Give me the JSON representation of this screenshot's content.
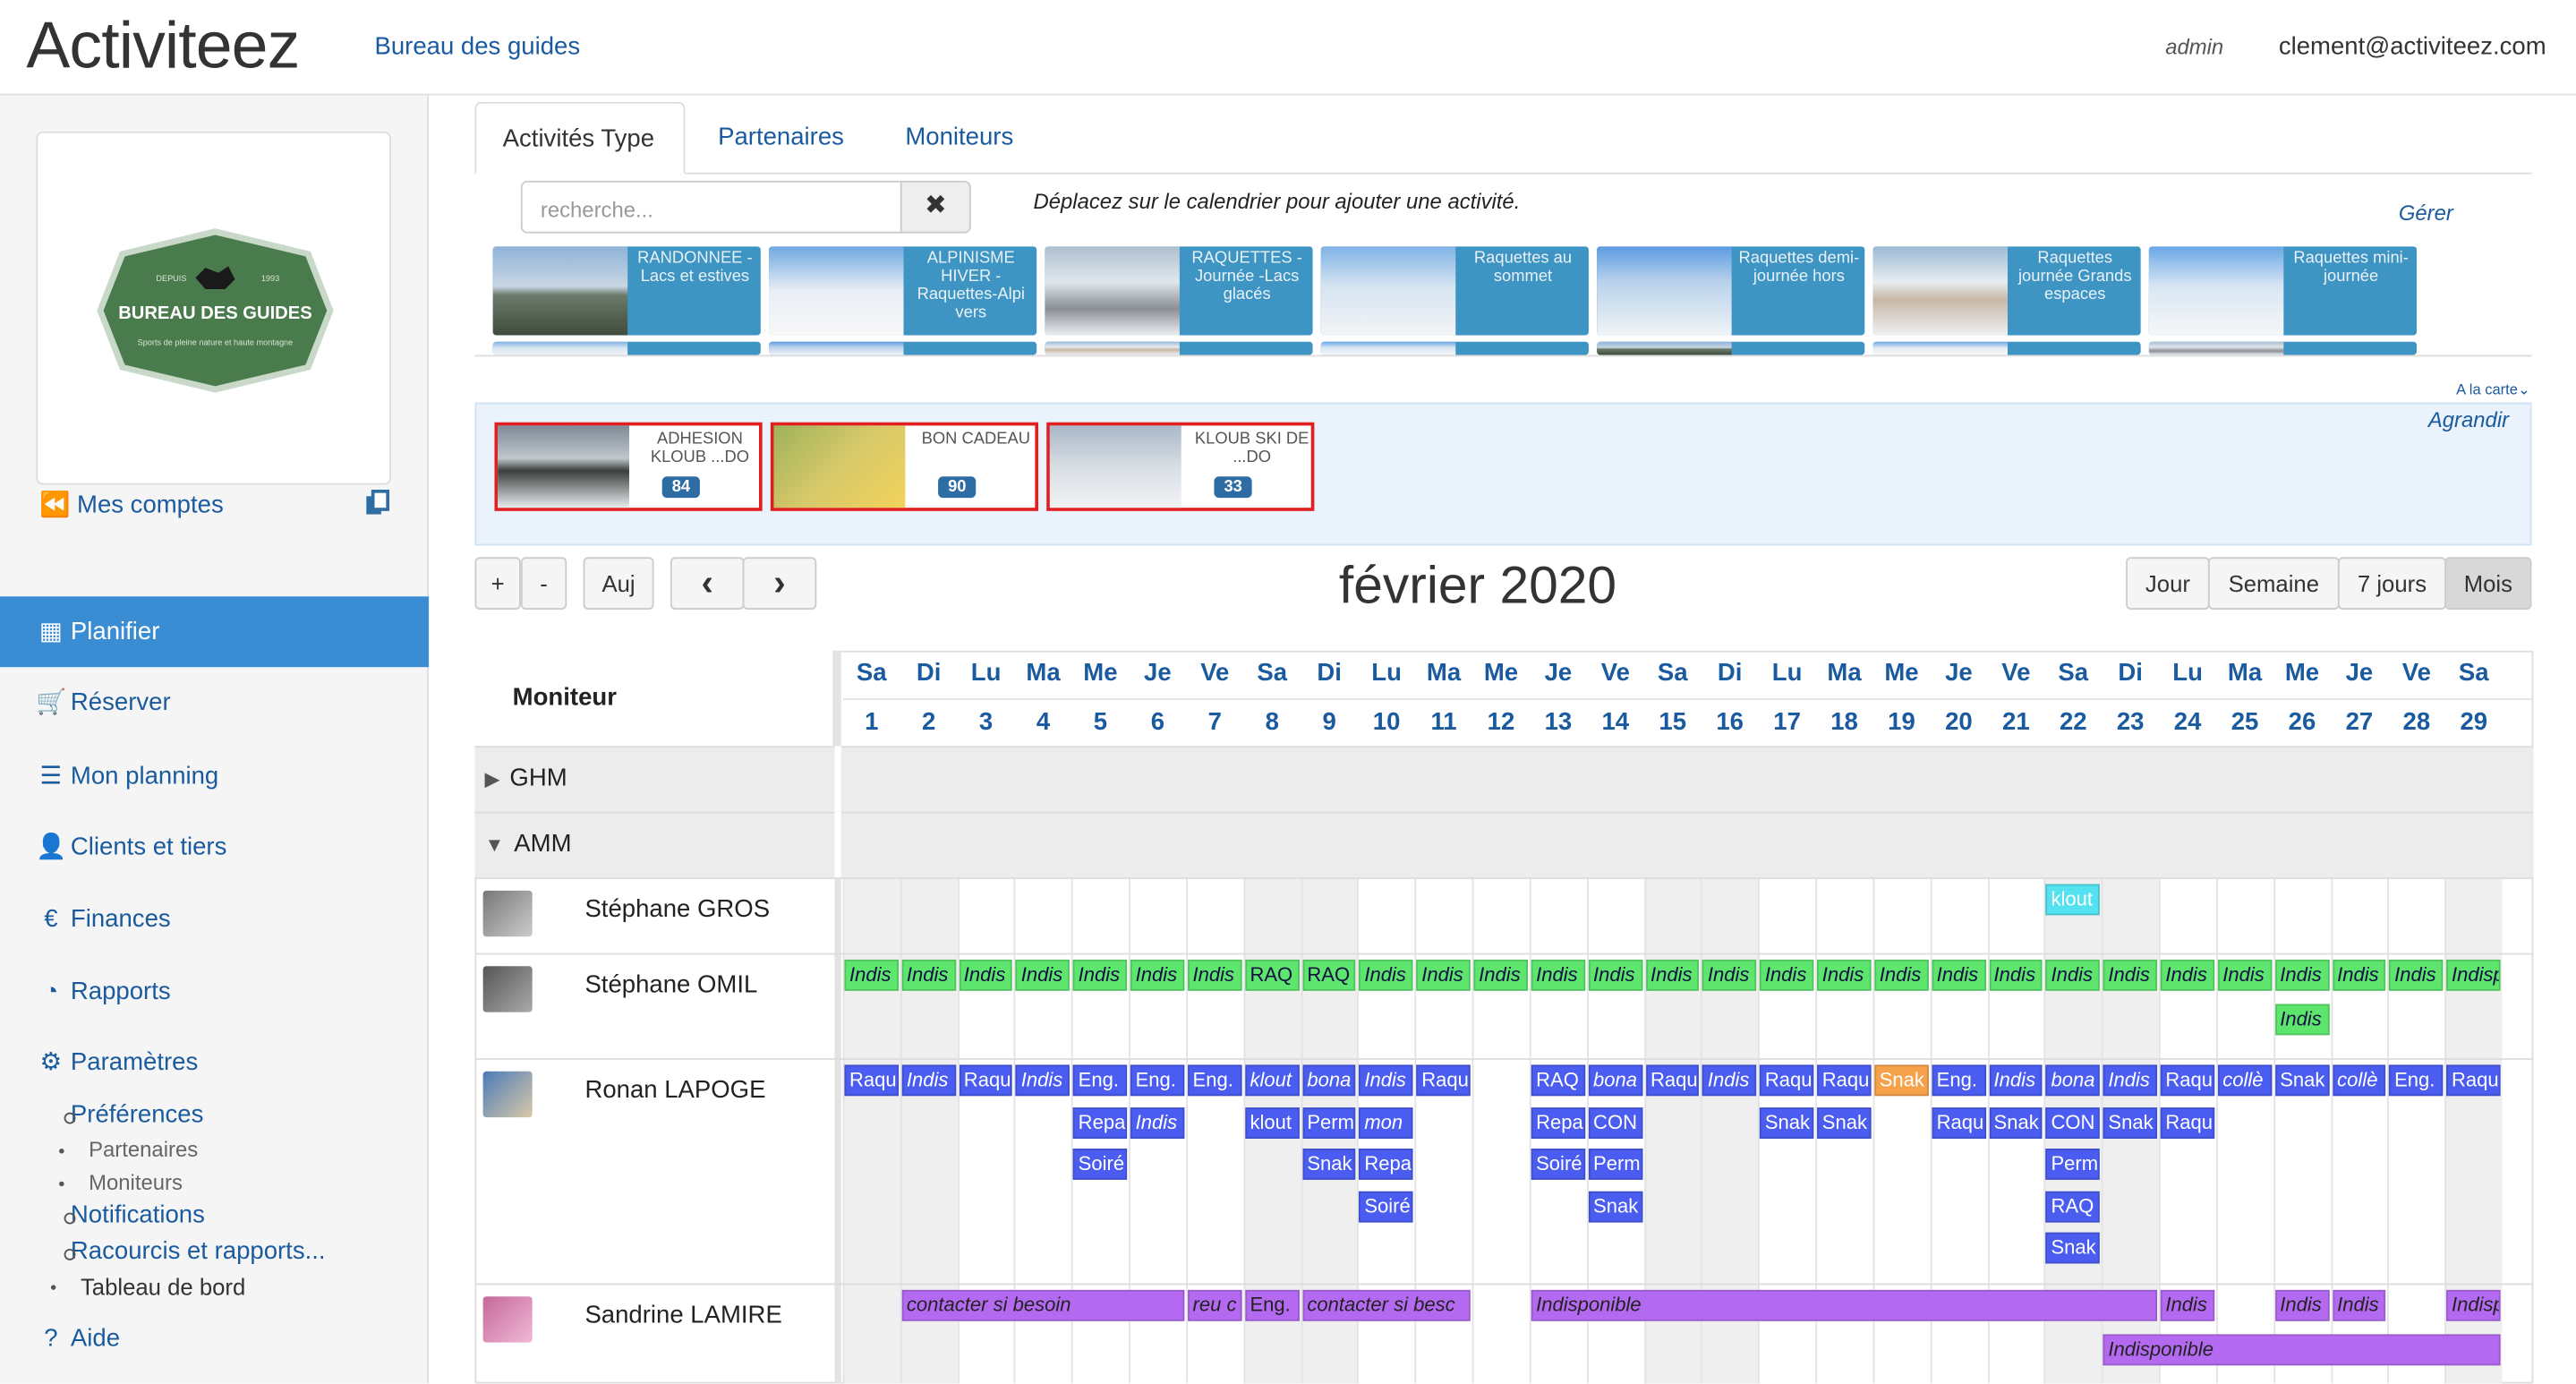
{
  "app": {
    "logo": "Activiteez",
    "office_link": "Bureau des guides",
    "user_role": "admin",
    "user_email": "clement@activiteez.com"
  },
  "sidebar": {
    "logo_text": "BUREAU DES GUIDES",
    "logo_sub": "Sports de pleine nature et haute montagne",
    "logo_year_left": "DEPUIS",
    "logo_year_right": "1993",
    "mes_comptes": "Mes comptes",
    "nav": [
      {
        "label": "Planifier",
        "icon": "calendar-icon"
      },
      {
        "label": "Réserver",
        "icon": "cart-icon"
      },
      {
        "label": "Mon planning",
        "icon": "list-icon"
      },
      {
        "label": "Clients et tiers",
        "icon": "user-icon"
      },
      {
        "label": "Finances",
        "icon": "euro-icon"
      },
      {
        "label": "Rapports",
        "icon": "dashboard-icon"
      },
      {
        "label": "Paramètres",
        "icon": "gear-icon"
      }
    ],
    "preferences": "Préférences",
    "partenaires": "Partenaires",
    "moniteurs": "Moniteurs",
    "notifications": "Notifications",
    "raccourcis": "Racourcis et rapports...",
    "tableau": "Tableau de bord",
    "aide": "Aide"
  },
  "tabs": [
    "Activités Type",
    "Partenaires",
    "Moniteurs"
  ],
  "search": {
    "placeholder": "recherche..."
  },
  "drag_hint": "Déplacez sur le calendrier pour ajouter une activité.",
  "gerer": "Gérer",
  "activity_cards": [
    {
      "label": "RANDONNEE - Lacs et estives"
    },
    {
      "label": "ALPINISME HIVER - Raquettes-Alpi vers"
    },
    {
      "label": "RAQUETTES - Journée -Lacs glacés"
    },
    {
      "label": "Raquettes au sommet"
    },
    {
      "label": "Raquettes demi-journée hors"
    },
    {
      "label": "Raquettes journée Grands espaces"
    },
    {
      "label": "Raquettes mini-journée"
    }
  ],
  "a_la_carte": "A la carte",
  "agrandir": "Agrandir",
  "carte_cards": [
    {
      "label": "ADHESION KLOUB ...DO",
      "badge": "84"
    },
    {
      "label": "BON CADEAU",
      "badge": "90"
    },
    {
      "label": "KLOUB SKI DE ...DO",
      "badge": "33"
    }
  ],
  "toolbar": {
    "plus": "+",
    "minus": "-",
    "today": "Auj",
    "prev": "‹",
    "next": "›",
    "views": [
      "Jour",
      "Semaine",
      "7 jours",
      "Mois"
    ],
    "active_view": "Mois"
  },
  "calendar": {
    "title": "février 2020",
    "moniteur_header": "Moniteur",
    "day_names": [
      "Sa",
      "Di",
      "Lu",
      "Ma",
      "Me",
      "Je",
      "Ve",
      "Sa",
      "Di",
      "Lu",
      "Ma",
      "Me",
      "Je",
      "Ve",
      "Sa",
      "Di",
      "Lu",
      "Ma",
      "Me",
      "Je",
      "Ve",
      "Sa",
      "Di",
      "Lu",
      "Ma",
      "Me",
      "Je",
      "Ve",
      "Sa"
    ],
    "day_numbers": [
      "1",
      "2",
      "3",
      "4",
      "5",
      "6",
      "7",
      "8",
      "9",
      "10",
      "11",
      "12",
      "13",
      "14",
      "15",
      "16",
      "17",
      "18",
      "19",
      "20",
      "21",
      "22",
      "23",
      "24",
      "25",
      "26",
      "27",
      "28",
      "29"
    ],
    "groups": [
      "GHM",
      "AMM"
    ],
    "moniteurs": [
      "Stéphane GROS",
      "Stéphane OMIL",
      "Ronan LAPOGE",
      "Sandrine LAMIRE"
    ],
    "events": [
      {
        "row": 0,
        "line": 0,
        "start": 22,
        "span": 1,
        "text": "klout",
        "color": "cyan",
        "italic": false
      },
      {
        "row": 1,
        "line": 0,
        "start": 1,
        "span": 1,
        "text": "Indis",
        "color": "green",
        "italic": true
      },
      {
        "row": 1,
        "line": 0,
        "start": 2,
        "span": 1,
        "text": "Indis",
        "color": "green",
        "italic": true
      },
      {
        "row": 1,
        "line": 0,
        "start": 3,
        "span": 1,
        "text": "Indis",
        "color": "green",
        "italic": true
      },
      {
        "row": 1,
        "line": 0,
        "start": 4,
        "span": 1,
        "text": "Indis",
        "color": "green",
        "italic": true
      },
      {
        "row": 1,
        "line": 0,
        "start": 5,
        "span": 1,
        "text": "Indis",
        "color": "green",
        "italic": true
      },
      {
        "row": 1,
        "line": 0,
        "start": 6,
        "span": 1,
        "text": "Indis",
        "color": "green",
        "italic": true
      },
      {
        "row": 1,
        "line": 0,
        "start": 7,
        "span": 1,
        "text": "Indis",
        "color": "green",
        "italic": true
      },
      {
        "row": 1,
        "line": 0,
        "start": 8,
        "span": 1,
        "text": "RAQ",
        "color": "green",
        "italic": false
      },
      {
        "row": 1,
        "line": 0,
        "start": 9,
        "span": 1,
        "text": "RAQ",
        "color": "green",
        "italic": false
      },
      {
        "row": 1,
        "line": 0,
        "start": 10,
        "span": 1,
        "text": "Indis",
        "color": "green",
        "italic": true
      },
      {
        "row": 1,
        "line": 0,
        "start": 11,
        "span": 1,
        "text": "Indis",
        "color": "green",
        "italic": true
      },
      {
        "row": 1,
        "line": 0,
        "start": 12,
        "span": 1,
        "text": "Indis",
        "color": "green",
        "italic": true
      },
      {
        "row": 1,
        "line": 0,
        "start": 13,
        "span": 1,
        "text": "Indis",
        "color": "green",
        "italic": true
      },
      {
        "row": 1,
        "line": 0,
        "start": 14,
        "span": 1,
        "text": "Indis",
        "color": "green",
        "italic": true
      },
      {
        "row": 1,
        "line": 0,
        "start": 15,
        "span": 1,
        "text": "Indis",
        "color": "green",
        "italic": true
      },
      {
        "row": 1,
        "line": 0,
        "start": 16,
        "span": 1,
        "text": "Indis",
        "color": "green",
        "italic": true
      },
      {
        "row": 1,
        "line": 0,
        "start": 17,
        "span": 1,
        "text": "Indis",
        "color": "green",
        "italic": true
      },
      {
        "row": 1,
        "line": 0,
        "start": 18,
        "span": 1,
        "text": "Indis",
        "color": "green",
        "italic": true
      },
      {
        "row": 1,
        "line": 0,
        "start": 19,
        "span": 1,
        "text": "Indis",
        "color": "green",
        "italic": true
      },
      {
        "row": 1,
        "line": 0,
        "start": 20,
        "span": 1,
        "text": "Indis",
        "color": "green",
        "italic": true
      },
      {
        "row": 1,
        "line": 0,
        "start": 21,
        "span": 1,
        "text": "Indis",
        "color": "green",
        "italic": true
      },
      {
        "row": 1,
        "line": 0,
        "start": 22,
        "span": 1,
        "text": "Indis",
        "color": "green",
        "italic": true
      },
      {
        "row": 1,
        "line": 0,
        "start": 23,
        "span": 1,
        "text": "Indis",
        "color": "green",
        "italic": true
      },
      {
        "row": 1,
        "line": 0,
        "start": 24,
        "span": 1,
        "text": "Indis",
        "color": "green",
        "italic": true
      },
      {
        "row": 1,
        "line": 0,
        "start": 25,
        "span": 1,
        "text": "Indis",
        "color": "green",
        "italic": true
      },
      {
        "row": 1,
        "line": 0,
        "start": 26,
        "span": 1,
        "text": "Indis",
        "color": "green",
        "italic": true
      },
      {
        "row": 1,
        "line": 0,
        "start": 27,
        "span": 1,
        "text": "Indis",
        "color": "green",
        "italic": true
      },
      {
        "row": 1,
        "line": 0,
        "start": 28,
        "span": 1,
        "text": "Indis",
        "color": "green",
        "italic": true
      },
      {
        "row": 1,
        "line": 0,
        "start": 29,
        "span": 1,
        "text": "Indispo",
        "color": "green",
        "italic": true
      },
      {
        "row": 1,
        "line": 1,
        "start": 26,
        "span": 1,
        "text": "Indis",
        "color": "green",
        "italic": true
      },
      {
        "row": 2,
        "line": 0,
        "start": 1,
        "span": 1,
        "text": "Raqu",
        "color": "blue",
        "italic": false
      },
      {
        "row": 2,
        "line": 0,
        "start": 2,
        "span": 1,
        "text": "Indis",
        "color": "blue",
        "italic": true
      },
      {
        "row": 2,
        "line": 0,
        "start": 3,
        "span": 1,
        "text": "Raqu",
        "color": "blue",
        "italic": false
      },
      {
        "row": 2,
        "line": 0,
        "start": 4,
        "span": 1,
        "text": "Indis",
        "color": "blue",
        "italic": true
      },
      {
        "row": 2,
        "line": 0,
        "start": 5,
        "span": 1,
        "text": "Eng.",
        "color": "blue",
        "italic": false
      },
      {
        "row": 2,
        "line": 0,
        "start": 6,
        "span": 1,
        "text": "Eng.",
        "color": "blue",
        "italic": false
      },
      {
        "row": 2,
        "line": 0,
        "start": 7,
        "span": 1,
        "text": "Eng.",
        "color": "blue",
        "italic": false
      },
      {
        "row": 2,
        "line": 0,
        "start": 8,
        "span": 1,
        "text": "klout",
        "color": "blue",
        "italic": true
      },
      {
        "row": 2,
        "line": 0,
        "start": 9,
        "span": 1,
        "text": "bona",
        "color": "blue",
        "italic": true
      },
      {
        "row": 2,
        "line": 0,
        "start": 10,
        "span": 1,
        "text": "Indis",
        "color": "blue",
        "italic": true
      },
      {
        "row": 2,
        "line": 0,
        "start": 11,
        "span": 1,
        "text": "Raqu",
        "color": "blue",
        "italic": false
      },
      {
        "row": 2,
        "line": 0,
        "start": 13,
        "span": 1,
        "text": "RAQ",
        "color": "blue",
        "italic": false
      },
      {
        "row": 2,
        "line": 0,
        "start": 14,
        "span": 1,
        "text": "bona",
        "color": "blue",
        "italic": true
      },
      {
        "row": 2,
        "line": 0,
        "start": 15,
        "span": 1,
        "text": "Raqu",
        "color": "blue",
        "italic": false
      },
      {
        "row": 2,
        "line": 0,
        "start": 16,
        "span": 1,
        "text": "Indis",
        "color": "blue",
        "italic": true
      },
      {
        "row": 2,
        "line": 0,
        "start": 17,
        "span": 1,
        "text": "Raqu",
        "color": "blue",
        "italic": false
      },
      {
        "row": 2,
        "line": 0,
        "start": 18,
        "span": 1,
        "text": "Raqu",
        "color": "blue",
        "italic": false
      },
      {
        "row": 2,
        "line": 0,
        "start": 19,
        "span": 1,
        "text": "Snak",
        "color": "orange",
        "italic": false
      },
      {
        "row": 2,
        "line": 0,
        "start": 20,
        "span": 1,
        "text": "Eng.",
        "color": "blue",
        "italic": false
      },
      {
        "row": 2,
        "line": 0,
        "start": 21,
        "span": 1,
        "text": "Indis",
        "color": "blue",
        "italic": true
      },
      {
        "row": 2,
        "line": 0,
        "start": 22,
        "span": 1,
        "text": "bona",
        "color": "blue",
        "italic": true
      },
      {
        "row": 2,
        "line": 0,
        "start": 23,
        "span": 1,
        "text": "Indis",
        "color": "blue",
        "italic": true
      },
      {
        "row": 2,
        "line": 0,
        "start": 24,
        "span": 1,
        "text": "Raqu",
        "color": "blue",
        "italic": false
      },
      {
        "row": 2,
        "line": 0,
        "start": 25,
        "span": 1,
        "text": "collè",
        "color": "blue",
        "italic": true
      },
      {
        "row": 2,
        "line": 0,
        "start": 26,
        "span": 1,
        "text": "Snak",
        "color": "blue",
        "italic": false
      },
      {
        "row": 2,
        "line": 0,
        "start": 27,
        "span": 1,
        "text": "collè",
        "color": "blue",
        "italic": true
      },
      {
        "row": 2,
        "line": 0,
        "start": 28,
        "span": 1,
        "text": "Eng.",
        "color": "blue",
        "italic": false
      },
      {
        "row": 2,
        "line": 0,
        "start": 29,
        "span": 1,
        "text": "Raquet",
        "color": "blue",
        "italic": false
      },
      {
        "row": 2,
        "line": 1,
        "start": 5,
        "span": 1,
        "text": "Repa",
        "color": "blue",
        "italic": false
      },
      {
        "row": 2,
        "line": 1,
        "start": 6,
        "span": 1,
        "text": "Indis",
        "color": "blue",
        "italic": true
      },
      {
        "row": 2,
        "line": 1,
        "start": 8,
        "span": 1,
        "text": "klout",
        "color": "blue",
        "italic": false
      },
      {
        "row": 2,
        "line": 1,
        "start": 9,
        "span": 1,
        "text": "Perm",
        "color": "blue",
        "italic": false
      },
      {
        "row": 2,
        "line": 1,
        "start": 10,
        "span": 1,
        "text": "mon",
        "color": "blue",
        "italic": true
      },
      {
        "row": 2,
        "line": 1,
        "start": 13,
        "span": 1,
        "text": "Repa",
        "color": "blue",
        "italic": false
      },
      {
        "row": 2,
        "line": 1,
        "start": 14,
        "span": 1,
        "text": "CON",
        "color": "blue",
        "italic": false
      },
      {
        "row": 2,
        "line": 1,
        "start": 17,
        "span": 1,
        "text": "Snak",
        "color": "blue",
        "italic": false
      },
      {
        "row": 2,
        "line": 1,
        "start": 18,
        "span": 1,
        "text": "Snak",
        "color": "blue",
        "italic": false
      },
      {
        "row": 2,
        "line": 1,
        "start": 20,
        "span": 1,
        "text": "Raqu",
        "color": "blue",
        "italic": false
      },
      {
        "row": 2,
        "line": 1,
        "start": 21,
        "span": 1,
        "text": "Snak",
        "color": "blue",
        "italic": false
      },
      {
        "row": 2,
        "line": 1,
        "start": 22,
        "span": 1,
        "text": "CON",
        "color": "blue",
        "italic": false
      },
      {
        "row": 2,
        "line": 1,
        "start": 23,
        "span": 1,
        "text": "Snak",
        "color": "blue",
        "italic": false
      },
      {
        "row": 2,
        "line": 1,
        "start": 24,
        "span": 1,
        "text": "Raqu",
        "color": "blue",
        "italic": false
      },
      {
        "row": 2,
        "line": 2,
        "start": 5,
        "span": 1,
        "text": "Soiré",
        "color": "blue",
        "italic": false
      },
      {
        "row": 2,
        "line": 2,
        "start": 9,
        "span": 1,
        "text": "Snak",
        "color": "blue",
        "italic": false
      },
      {
        "row": 2,
        "line": 2,
        "start": 10,
        "span": 1,
        "text": "Repa",
        "color": "blue",
        "italic": false
      },
      {
        "row": 2,
        "line": 2,
        "start": 13,
        "span": 1,
        "text": "Soiré",
        "color": "blue",
        "italic": false
      },
      {
        "row": 2,
        "line": 2,
        "start": 14,
        "span": 1,
        "text": "Perm",
        "color": "blue",
        "italic": false
      },
      {
        "row": 2,
        "line": 2,
        "start": 22,
        "span": 1,
        "text": "Perm",
        "color": "blue",
        "italic": false
      },
      {
        "row": 2,
        "line": 3,
        "start": 10,
        "span": 1,
        "text": "Soiré",
        "color": "blue",
        "italic": false
      },
      {
        "row": 2,
        "line": 3,
        "start": 14,
        "span": 1,
        "text": "Snak",
        "color": "blue",
        "italic": false
      },
      {
        "row": 2,
        "line": 3,
        "start": 22,
        "span": 1,
        "text": "RAQ",
        "color": "blue",
        "italic": false
      },
      {
        "row": 2,
        "line": 4,
        "start": 22,
        "span": 1,
        "text": "Snak",
        "color": "blue",
        "italic": false
      },
      {
        "row": 3,
        "line": 0,
        "start": 2,
        "span": 5,
        "text": "contacter si besoin",
        "color": "purple",
        "italic": true
      },
      {
        "row": 3,
        "line": 0,
        "start": 7,
        "span": 1,
        "text": "reu c",
        "color": "purple",
        "italic": true
      },
      {
        "row": 3,
        "line": 0,
        "start": 8,
        "span": 1,
        "text": "Eng.",
        "color": "purple",
        "italic": false
      },
      {
        "row": 3,
        "line": 0,
        "start": 9,
        "span": 3,
        "text": "contacter si besc",
        "color": "purple",
        "italic": true
      },
      {
        "row": 3,
        "line": 0,
        "start": 13,
        "span": 11,
        "text": "Indisponible",
        "color": "purple",
        "italic": true
      },
      {
        "row": 3,
        "line": 0,
        "start": 24,
        "span": 1,
        "text": "Indis",
        "color": "purple",
        "italic": true
      },
      {
        "row": 3,
        "line": 0,
        "start": 26,
        "span": 1,
        "text": "Indis",
        "color": "purple",
        "italic": true
      },
      {
        "row": 3,
        "line": 0,
        "start": 27,
        "span": 1,
        "text": "Indis",
        "color": "purple",
        "italic": true
      },
      {
        "row": 3,
        "line": 0,
        "start": 29,
        "span": 1,
        "text": "Indispo",
        "color": "purple",
        "italic": true
      },
      {
        "row": 3,
        "line": 1,
        "start": 23,
        "span": 7,
        "text": "Indisponible",
        "color": "purple",
        "italic": true
      }
    ]
  },
  "colors": {
    "accent": "#3a8dd3",
    "link": "#1a5a9e",
    "green": "#5ee56e",
    "blue": "#4a5df0",
    "purple": "#b46af0",
    "orange": "#f6a24a",
    "cyan": "#55e2f0"
  }
}
